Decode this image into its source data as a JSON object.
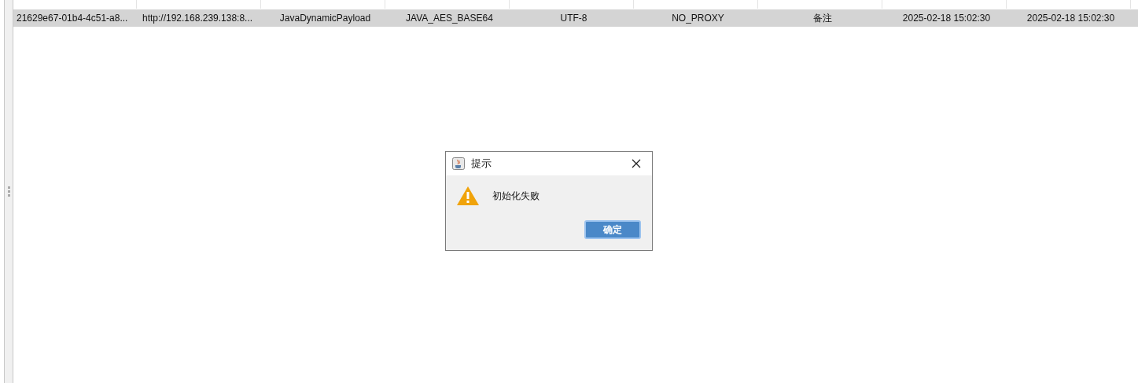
{
  "table": {
    "rows": [
      {
        "selected": true,
        "cells": [
          "21629e67-01b4-4c51-a8...",
          "http://192.168.239.138:8...",
          "JavaDynamicPayload",
          "JAVA_AES_BASE64",
          "UTF-8",
          "NO_PROXY",
          "备注",
          "2025-02-18 15:02:30",
          "2025-02-18 15:02:30"
        ]
      }
    ]
  },
  "dialog": {
    "title": "提示",
    "message": "初始化失败",
    "buttons": [
      "确定"
    ]
  }
}
